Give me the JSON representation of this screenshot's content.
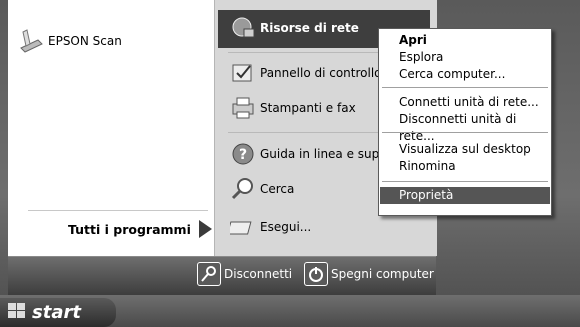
{
  "left_panel": {
    "pinned": [
      {
        "label": "EPSON Scan",
        "icon": "scanner-icon"
      }
    ],
    "all_programs_label": "Tutti i programmi"
  },
  "right_panel": {
    "items": [
      {
        "label": "Risorse di rete",
        "icon": "network-places-icon"
      },
      {
        "label": "Pannello di controllo",
        "icon": "control-panel-icon"
      },
      {
        "label": "Stampanti e fax",
        "icon": "printer-icon"
      },
      {
        "label": "Guida in linea e suppo",
        "icon": "help-icon"
      },
      {
        "label": "Cerca",
        "icon": "search-icon"
      },
      {
        "label": "Esegui...",
        "icon": "run-icon"
      }
    ]
  },
  "bottom_bar": {
    "logoff_label": "Disconnetti",
    "shutdown_label": "Spegni computer"
  },
  "context_menu": {
    "items": [
      {
        "label": "Apri",
        "bold": true
      },
      {
        "label": "Esplora"
      },
      {
        "label": "Cerca computer..."
      },
      {
        "label": "Connetti unità di rete..."
      },
      {
        "label": "Disconnetti unità di rete..."
      },
      {
        "label": "Visualizza sul desktop"
      },
      {
        "label": "Rinomina"
      },
      {
        "label": "Proprietà",
        "selected": true
      }
    ]
  },
  "taskbar": {
    "start_label": "start"
  }
}
